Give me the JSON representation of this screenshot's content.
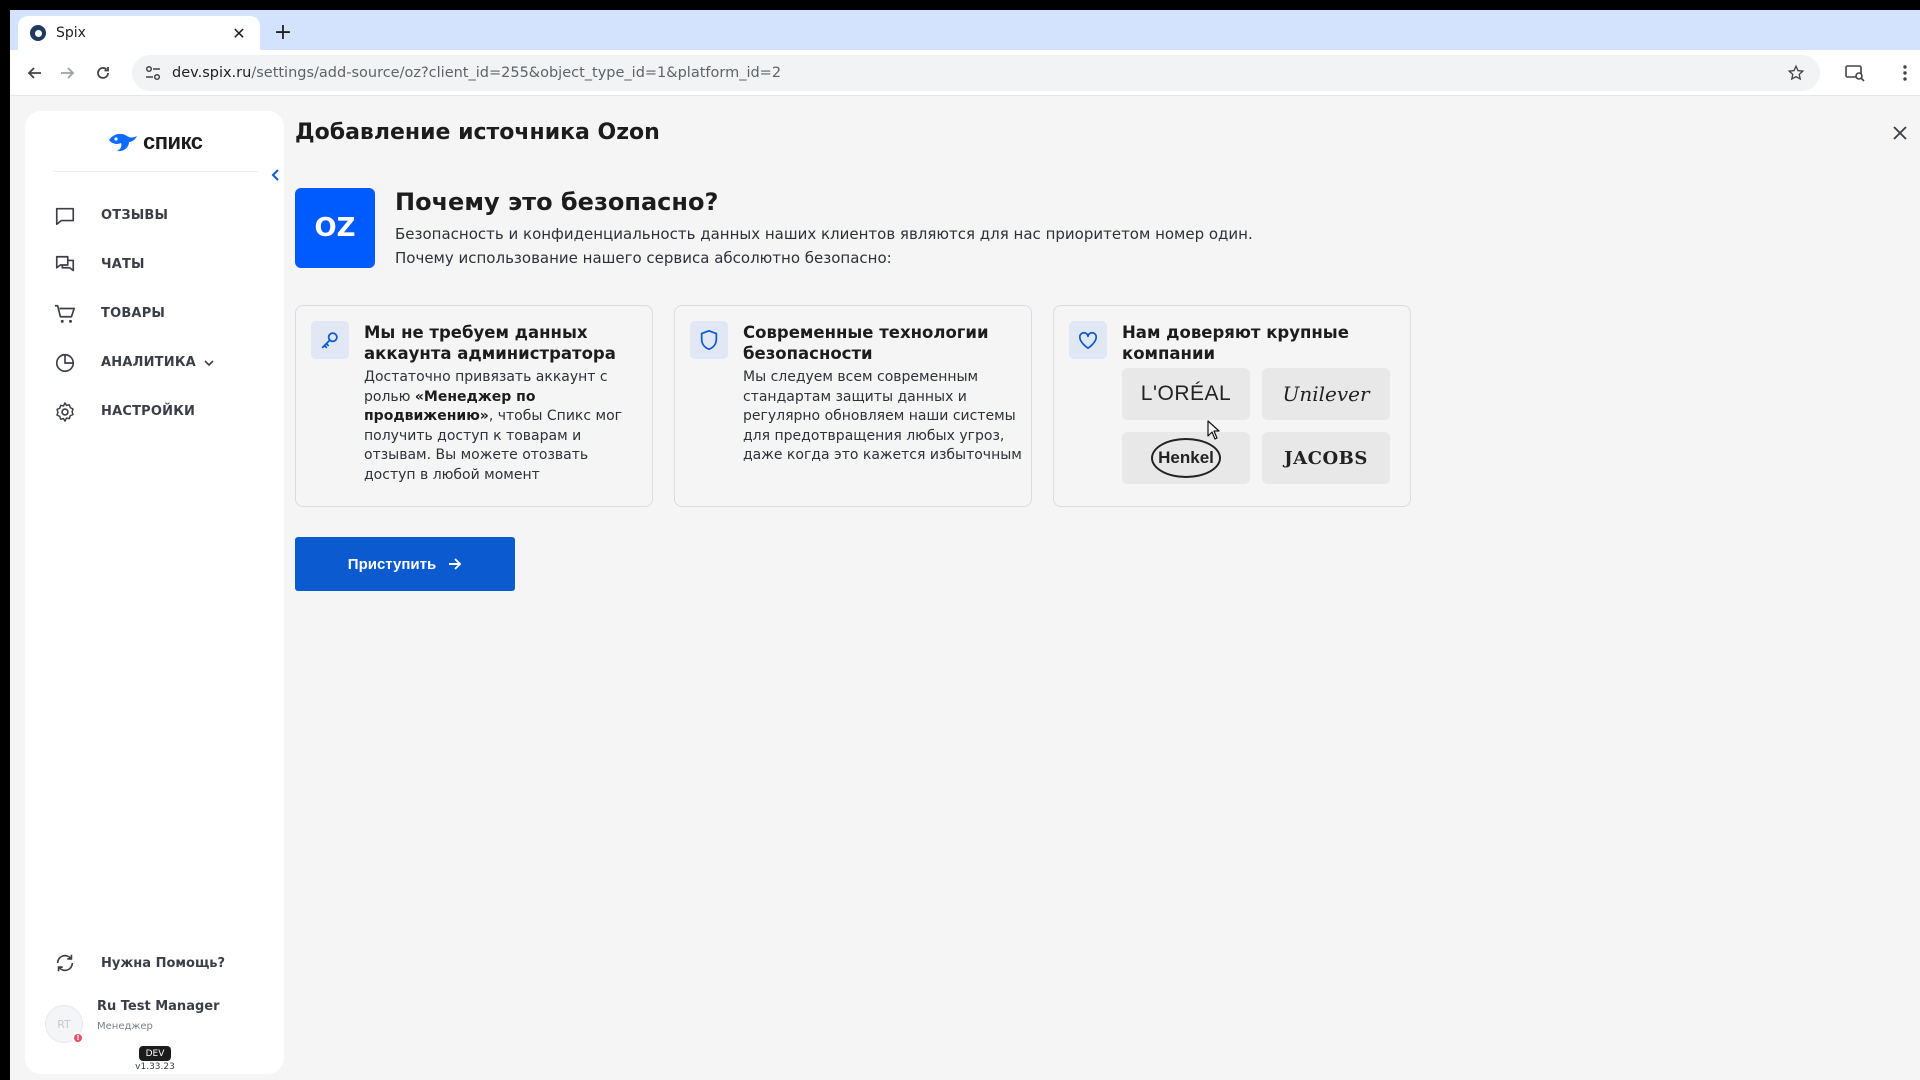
{
  "browser": {
    "tab_title": "Spix",
    "tab_close": "✕",
    "new_tab": "+",
    "url_host": "dev.spix.ru",
    "url_path": "/settings/add-source/oz?client_id=255&object_type_id=1&platform_id=2"
  },
  "sidebar": {
    "logo_text": "спикс",
    "items": [
      {
        "label": "ОТЗЫВЫ",
        "icon": "message-square-icon"
      },
      {
        "label": "ЧАТЫ",
        "icon": "chats-icon"
      },
      {
        "label": "ТОВАРЫ",
        "icon": "cart-icon"
      },
      {
        "label": "АНАЛИТИКА",
        "icon": "pie-chart-icon"
      },
      {
        "label": "НАСТРОЙКИ",
        "icon": "gear-icon"
      }
    ],
    "help_label": "Нужна Помощь?",
    "user": {
      "initials": "RT",
      "name": "Ru Test Manager",
      "role": "Менеджер",
      "alert": "!"
    },
    "env_badge": "DEV",
    "version": "v1.33.23"
  },
  "main": {
    "title": "Добавление источника Ozon",
    "tile_label": "OZ",
    "why_title": "Почему это безопасно?",
    "why_line1": "Безопасность и конфиденциальность данных наших клиентов являются для нас приоритетом номер один.",
    "why_line2": "Почему использование нашего сервиса абсолютно безопасно:",
    "cards": [
      {
        "title": "Мы не требуем данных аккаунта администратора",
        "body_pre": "Достаточно привязать аккаунт с ролью ",
        "body_bold": "«Менеджер по продвижению»",
        "body_post": ", чтобы Спикс мог получить доступ к товарам и отзывам. Вы можете отозвать доступ в любой момент"
      },
      {
        "title": "Современные технологии безопасности",
        "body": "Мы следуем всем современным стандартам защиты данных и регулярно обновляем наши системы для предотвращения любых угроз, даже когда это кажется избыточным"
      },
      {
        "title": "Нам доверяют крупные компании",
        "brands": [
          "L'ORÉAL",
          "Unilever",
          "Henkel",
          "JACOBS"
        ]
      }
    ],
    "start_button": "Приступить"
  },
  "colors": {
    "accent": "#0c5ad0",
    "ozon_blue": "#005bff",
    "chrome_tabbar": "#d3e3fd",
    "app_bg": "#f5f5f5"
  }
}
